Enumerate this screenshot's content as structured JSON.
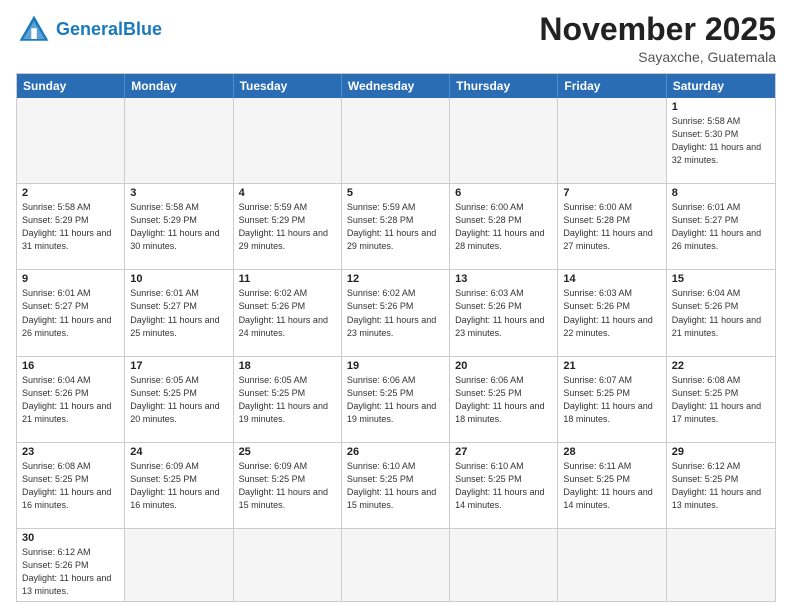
{
  "header": {
    "logo_general": "General",
    "logo_blue": "Blue",
    "month_title": "November 2025",
    "location": "Sayaxche, Guatemala"
  },
  "weekdays": [
    "Sunday",
    "Monday",
    "Tuesday",
    "Wednesday",
    "Thursday",
    "Friday",
    "Saturday"
  ],
  "rows": [
    [
      {
        "day": "",
        "empty": true
      },
      {
        "day": "",
        "empty": true
      },
      {
        "day": "",
        "empty": true
      },
      {
        "day": "",
        "empty": true
      },
      {
        "day": "",
        "empty": true
      },
      {
        "day": "",
        "empty": true
      },
      {
        "day": "1",
        "sunrise": "5:58 AM",
        "sunset": "5:30 PM",
        "daylight": "11 hours and 32 minutes."
      }
    ],
    [
      {
        "day": "2",
        "sunrise": "5:58 AM",
        "sunset": "5:29 PM",
        "daylight": "11 hours and 31 minutes."
      },
      {
        "day": "3",
        "sunrise": "5:58 AM",
        "sunset": "5:29 PM",
        "daylight": "11 hours and 30 minutes."
      },
      {
        "day": "4",
        "sunrise": "5:59 AM",
        "sunset": "5:29 PM",
        "daylight": "11 hours and 29 minutes."
      },
      {
        "day": "5",
        "sunrise": "5:59 AM",
        "sunset": "5:28 PM",
        "daylight": "11 hours and 29 minutes."
      },
      {
        "day": "6",
        "sunrise": "6:00 AM",
        "sunset": "5:28 PM",
        "daylight": "11 hours and 28 minutes."
      },
      {
        "day": "7",
        "sunrise": "6:00 AM",
        "sunset": "5:28 PM",
        "daylight": "11 hours and 27 minutes."
      },
      {
        "day": "8",
        "sunrise": "6:01 AM",
        "sunset": "5:27 PM",
        "daylight": "11 hours and 26 minutes."
      }
    ],
    [
      {
        "day": "9",
        "sunrise": "6:01 AM",
        "sunset": "5:27 PM",
        "daylight": "11 hours and 26 minutes."
      },
      {
        "day": "10",
        "sunrise": "6:01 AM",
        "sunset": "5:27 PM",
        "daylight": "11 hours and 25 minutes."
      },
      {
        "day": "11",
        "sunrise": "6:02 AM",
        "sunset": "5:26 PM",
        "daylight": "11 hours and 24 minutes."
      },
      {
        "day": "12",
        "sunrise": "6:02 AM",
        "sunset": "5:26 PM",
        "daylight": "11 hours and 23 minutes."
      },
      {
        "day": "13",
        "sunrise": "6:03 AM",
        "sunset": "5:26 PM",
        "daylight": "11 hours and 23 minutes."
      },
      {
        "day": "14",
        "sunrise": "6:03 AM",
        "sunset": "5:26 PM",
        "daylight": "11 hours and 22 minutes."
      },
      {
        "day": "15",
        "sunrise": "6:04 AM",
        "sunset": "5:26 PM",
        "daylight": "11 hours and 21 minutes."
      }
    ],
    [
      {
        "day": "16",
        "sunrise": "6:04 AM",
        "sunset": "5:26 PM",
        "daylight": "11 hours and 21 minutes."
      },
      {
        "day": "17",
        "sunrise": "6:05 AM",
        "sunset": "5:25 PM",
        "daylight": "11 hours and 20 minutes."
      },
      {
        "day": "18",
        "sunrise": "6:05 AM",
        "sunset": "5:25 PM",
        "daylight": "11 hours and 19 minutes."
      },
      {
        "day": "19",
        "sunrise": "6:06 AM",
        "sunset": "5:25 PM",
        "daylight": "11 hours and 19 minutes."
      },
      {
        "day": "20",
        "sunrise": "6:06 AM",
        "sunset": "5:25 PM",
        "daylight": "11 hours and 18 minutes."
      },
      {
        "day": "21",
        "sunrise": "6:07 AM",
        "sunset": "5:25 PM",
        "daylight": "11 hours and 18 minutes."
      },
      {
        "day": "22",
        "sunrise": "6:08 AM",
        "sunset": "5:25 PM",
        "daylight": "11 hours and 17 minutes."
      }
    ],
    [
      {
        "day": "23",
        "sunrise": "6:08 AM",
        "sunset": "5:25 PM",
        "daylight": "11 hours and 16 minutes."
      },
      {
        "day": "24",
        "sunrise": "6:09 AM",
        "sunset": "5:25 PM",
        "daylight": "11 hours and 16 minutes."
      },
      {
        "day": "25",
        "sunrise": "6:09 AM",
        "sunset": "5:25 PM",
        "daylight": "11 hours and 15 minutes."
      },
      {
        "day": "26",
        "sunrise": "6:10 AM",
        "sunset": "5:25 PM",
        "daylight": "11 hours and 15 minutes."
      },
      {
        "day": "27",
        "sunrise": "6:10 AM",
        "sunset": "5:25 PM",
        "daylight": "11 hours and 14 minutes."
      },
      {
        "day": "28",
        "sunrise": "6:11 AM",
        "sunset": "5:25 PM",
        "daylight": "11 hours and 14 minutes."
      },
      {
        "day": "29",
        "sunrise": "6:12 AM",
        "sunset": "5:25 PM",
        "daylight": "11 hours and 13 minutes."
      }
    ],
    [
      {
        "day": "30",
        "sunrise": "6:12 AM",
        "sunset": "5:26 PM",
        "daylight": "11 hours and 13 minutes.",
        "has_data": true
      },
      {
        "day": "",
        "empty": true
      },
      {
        "day": "",
        "empty": true
      },
      {
        "day": "",
        "empty": true
      },
      {
        "day": "",
        "empty": true
      },
      {
        "day": "",
        "empty": true
      },
      {
        "day": "",
        "empty": true
      }
    ]
  ]
}
